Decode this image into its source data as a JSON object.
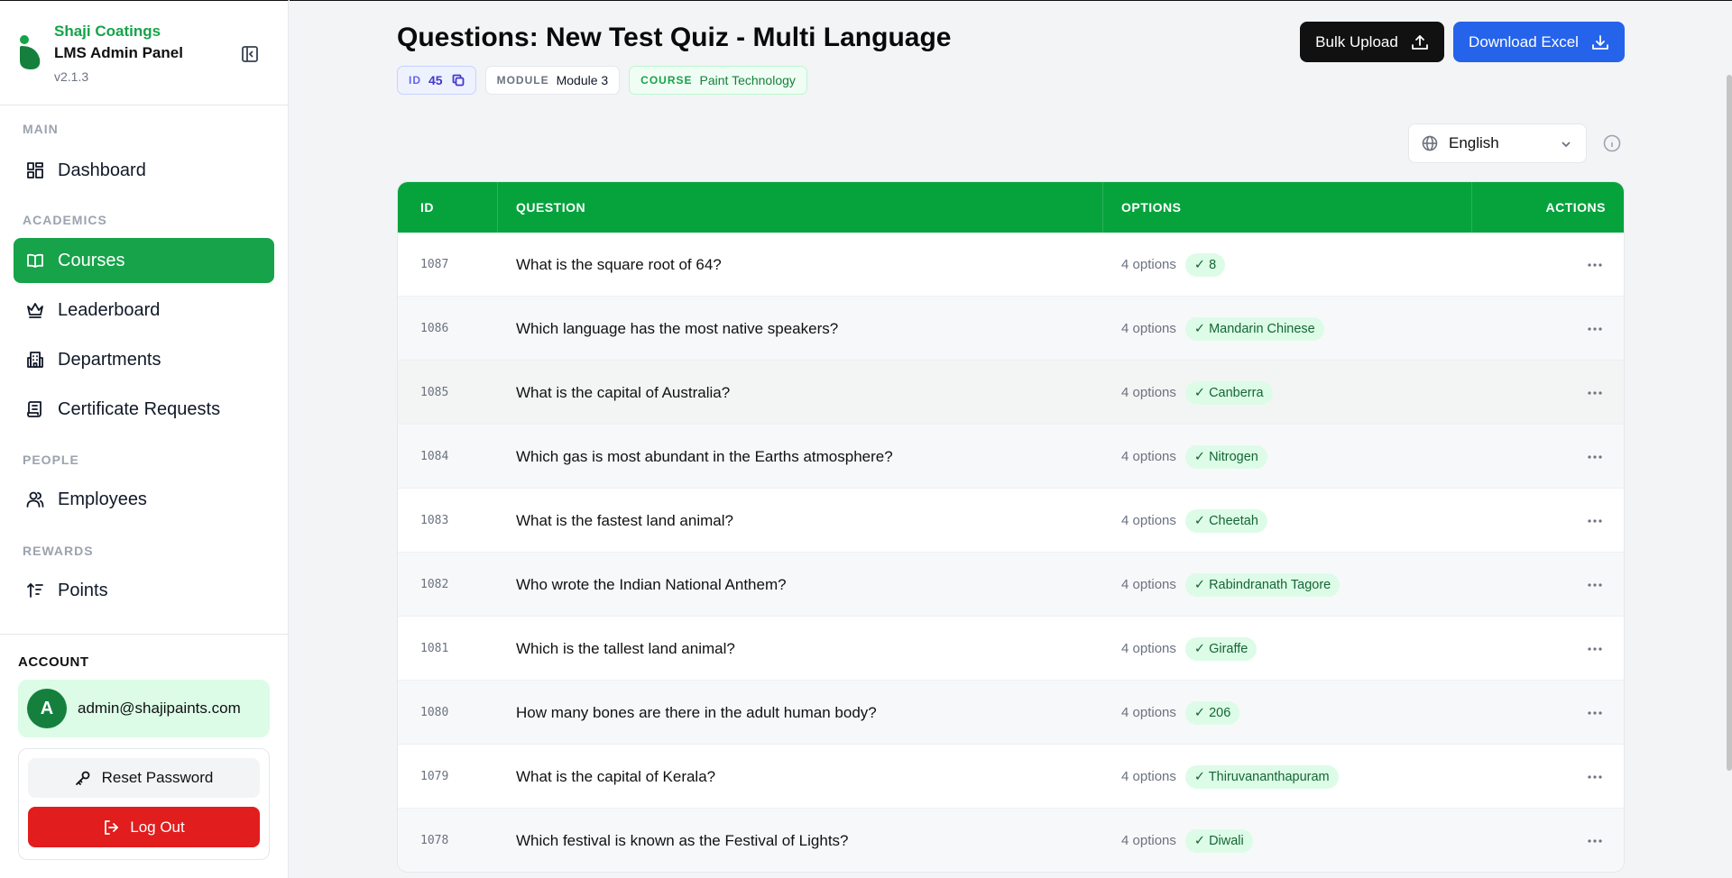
{
  "brand": {
    "company": "Shaji Coatings",
    "panel": "LMS Admin Panel",
    "version": "v2.1.3"
  },
  "nav": {
    "main_label": "MAIN",
    "dashboard": "Dashboard",
    "academics_label": "ACADEMICS",
    "courses": "Courses",
    "leaderboard": "Leaderboard",
    "departments": "Departments",
    "certificate_requests": "Certificate Requests",
    "people_label": "PEOPLE",
    "employees": "Employees",
    "rewards_label": "REWARDS",
    "points": "Points"
  },
  "account": {
    "label": "ACCOUNT",
    "avatar_initial": "A",
    "email": "admin@shajipaints.com",
    "reset_password": "Reset Password",
    "log_out": "Log Out"
  },
  "page": {
    "title": "Questions: New Test Quiz - Multi Language",
    "id_label": "ID",
    "id_value": "45",
    "module_label": "MODULE",
    "module_value": "Module 3",
    "course_label": "COURSE",
    "course_value": "Paint Technology",
    "bulk_upload": "Bulk Upload",
    "download_excel": "Download Excel",
    "language": "English"
  },
  "table": {
    "headers": {
      "id": "ID",
      "question": "QUESTION",
      "options": "OPTIONS",
      "actions": "ACTIONS"
    },
    "rows": [
      {
        "id": "1087",
        "question": "What is the square root of 64?",
        "options": "4 options",
        "answer": "✓ 8"
      },
      {
        "id": "1086",
        "question": "Which language has the most native speakers?",
        "options": "4 options",
        "answer": "✓ Mandarin Chinese"
      },
      {
        "id": "1085",
        "question": "What is the capital of Australia?",
        "options": "4 options",
        "answer": "✓ Canberra"
      },
      {
        "id": "1084",
        "question": "Which gas is most abundant in the Earths atmosphere?",
        "options": "4 options",
        "answer": "✓ Nitrogen"
      },
      {
        "id": "1083",
        "question": "What is the fastest land animal?",
        "options": "4 options",
        "answer": "✓ Cheetah"
      },
      {
        "id": "1082",
        "question": "Who wrote the Indian National Anthem?",
        "options": "4 options",
        "answer": "✓ Rabindranath Tagore"
      },
      {
        "id": "1081",
        "question": "Which is the tallest land animal?",
        "options": "4 options",
        "answer": "✓ Giraffe"
      },
      {
        "id": "1080",
        "question": "How many bones are there in the adult human body?",
        "options": "4 options",
        "answer": "✓ 206"
      },
      {
        "id": "1079",
        "question": "What is the capital of Kerala?",
        "options": "4 options",
        "answer": "✓ Thiruvananthapuram"
      },
      {
        "id": "1078",
        "question": "Which festival is known as the Festival of Lights?",
        "options": "4 options",
        "answer": "✓ Diwali"
      }
    ]
  },
  "colors": {
    "brand_green": "#16a34a",
    "header_green": "#06a33d",
    "primary_blue": "#2563eb",
    "danger_red": "#e11d1d"
  }
}
